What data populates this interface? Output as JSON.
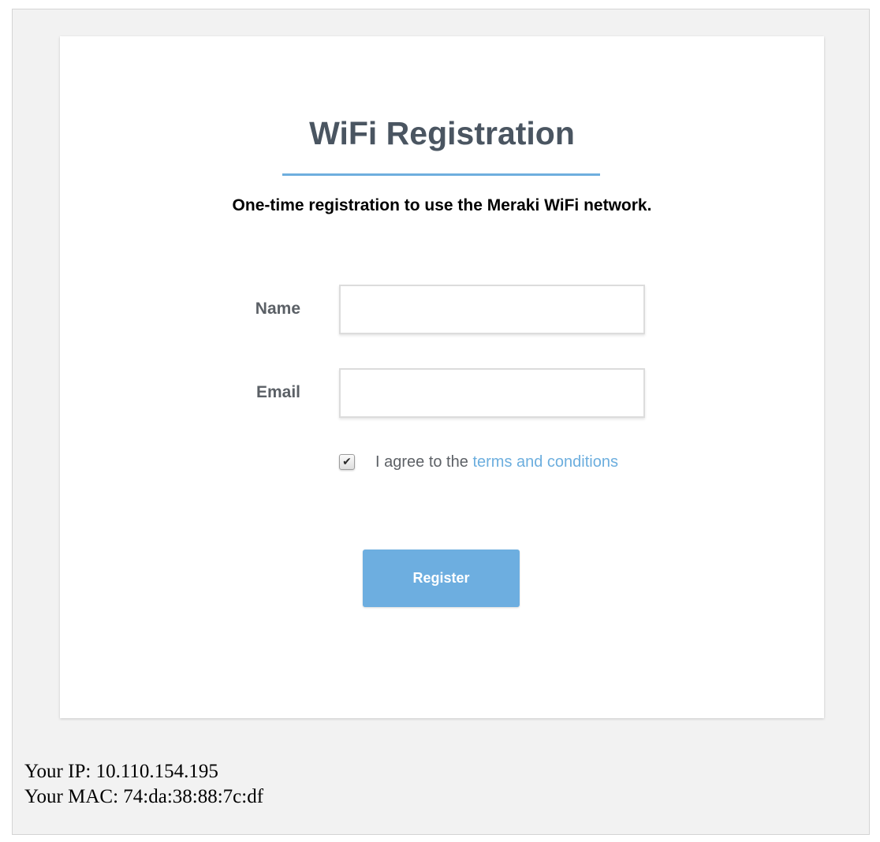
{
  "page": {
    "title": "WiFi Registration",
    "subtitle": "One-time registration to use the Meraki WiFi network."
  },
  "form": {
    "name_label": "Name",
    "name_value": "",
    "email_label": "Email",
    "email_value": "",
    "agree_checked": true,
    "agree_prefix": "I agree to the",
    "terms_link": "terms and conditions",
    "register_label": "Register"
  },
  "network_info": {
    "ip_label": "Your IP:",
    "ip_value": "10.110.154.195",
    "mac_label": "Your MAC:",
    "mac_value": "74:da:38:88:7c:df"
  },
  "colors": {
    "accent": "#6daee0",
    "title_text": "#4a5561",
    "label_text": "#5b6066",
    "page_background": "#f2f2f2"
  },
  "icons": {
    "checkbox": "checkmark-icon"
  }
}
